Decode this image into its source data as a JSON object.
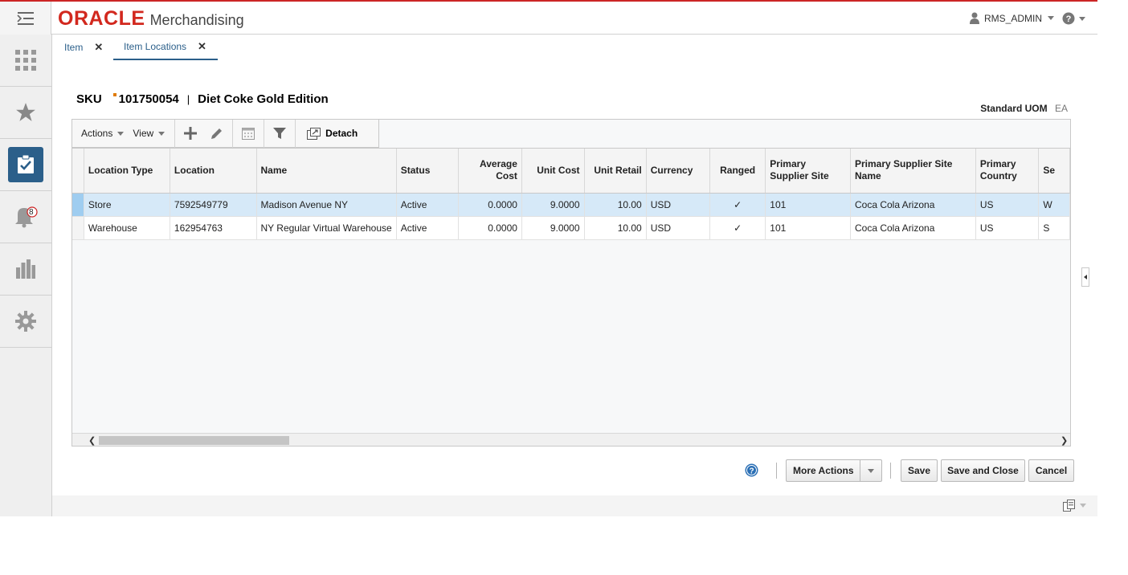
{
  "app": {
    "brand": "ORACLE",
    "product": "Merchandising",
    "user": "RMS_ADMIN"
  },
  "sidebar": {
    "items": [
      {
        "icon": "grid-icon"
      },
      {
        "icon": "star-icon"
      },
      {
        "icon": "task-clipboard-icon"
      },
      {
        "icon": "bell-icon",
        "badge": "8"
      },
      {
        "icon": "bar-chart-icon"
      },
      {
        "icon": "gear-icon"
      }
    ]
  },
  "tabs": [
    {
      "label": "Item"
    },
    {
      "label": "Item Locations"
    }
  ],
  "header": {
    "type": "SKU",
    "item_id": "101750054",
    "separator": "|",
    "description": "Diet Coke Gold Edition",
    "uom_label": "Standard UOM",
    "uom_value": "EA"
  },
  "toolbar": {
    "actions": "Actions",
    "view": "View",
    "detach": "Detach"
  },
  "table": {
    "columns": [
      "Location Type",
      "Location",
      "Name",
      "Status",
      "Average Cost",
      "Unit Cost",
      "Unit Retail",
      "Currency",
      "Ranged",
      "Primary Supplier Site",
      "Primary Supplier Site Name",
      "Primary Country",
      "Se"
    ],
    "rows": [
      [
        "Store",
        "7592549779",
        "Madison Avenue NY",
        "Active",
        "0.0000",
        "9.0000",
        "10.00",
        "USD",
        "✓",
        "101",
        "Coca Cola Arizona",
        "US",
        "W"
      ],
      [
        "Warehouse",
        "162954763",
        "NY Regular Virtual Warehouse",
        "Active",
        "0.0000",
        "9.0000",
        "10.00",
        "USD",
        "✓",
        "101",
        "Coca Cola Arizona",
        "US",
        "S"
      ]
    ]
  },
  "footer": {
    "more_actions": "More Actions",
    "save": "Save",
    "save_close": "Save and Close",
    "cancel": "Cancel"
  },
  "colors": {
    "brand_red": "#d2281e",
    "accent_blue": "#2b5f8a",
    "selected_row": "#d6e9f8"
  }
}
